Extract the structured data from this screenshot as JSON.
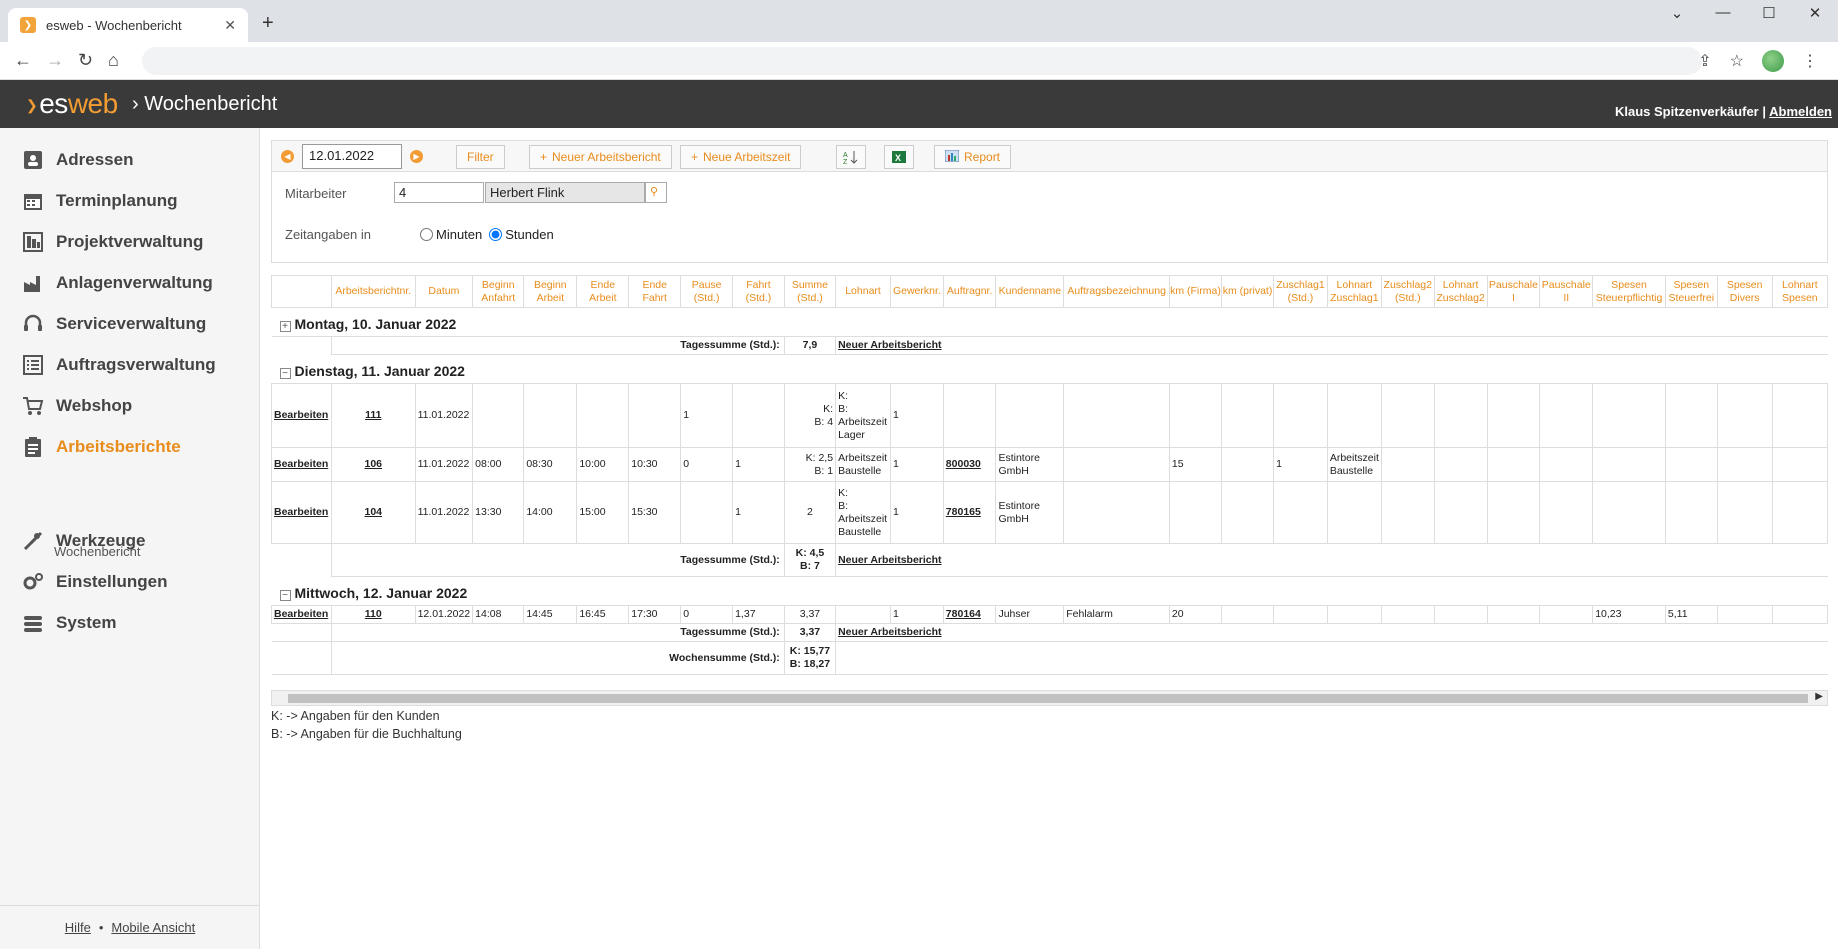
{
  "browser": {
    "tab_title": "esweb - Wochenbericht",
    "tab_close": "✕",
    "new_tab": "+",
    "win_min": "—",
    "win_max": "☐",
    "win_close": "✕",
    "chevron": "⌄"
  },
  "app": {
    "logo_es": "es",
    "logo_web": "web",
    "breadcrumb": "Wochenbericht",
    "user": "Klaus Spitzenverkäufer",
    "separator": "|",
    "logout": "Abmelden"
  },
  "sidebar": {
    "items": [
      {
        "label": "Adressen",
        "icon": "address-card-icon"
      },
      {
        "label": "Terminplanung",
        "icon": "calendar-icon"
      },
      {
        "label": "Projektverwaltung",
        "icon": "project-icon"
      },
      {
        "label": "Anlagenverwaltung",
        "icon": "factory-icon"
      },
      {
        "label": "Serviceverwaltung",
        "icon": "headset-icon"
      },
      {
        "label": "Auftragsverwaltung",
        "icon": "list-icon"
      },
      {
        "label": "Webshop",
        "icon": "cart-icon"
      },
      {
        "label": "Arbeitsberichte",
        "icon": "clipboard-icon"
      },
      {
        "label": "Werkzeuge",
        "icon": "tools-icon"
      },
      {
        "label": "Einstellungen",
        "icon": "gears-icon"
      },
      {
        "label": "System",
        "icon": "database-icon"
      }
    ],
    "sub_item": "Wochenbericht",
    "footer_help": "Hilfe",
    "footer_dot": "•",
    "footer_mobile": "Mobile Ansicht"
  },
  "toolbar": {
    "date": "12.01.2022",
    "filter": "Filter",
    "new_report": "Neuer Arbeitsbericht",
    "new_time": "Neue Arbeitszeit",
    "report": "Report"
  },
  "filter": {
    "employee_label": "Mitarbeiter",
    "employee_id": "4",
    "employee_name": "Herbert Flink",
    "time_label": "Zeitangaben in",
    "minutes": "Minuten",
    "hours": "Stunden"
  },
  "table": {
    "headers": [
      "",
      "Arbeitsberichtnr.",
      "Datum",
      "Beginn Anfahrt",
      "Beginn Arbeit",
      "Ende Arbeit",
      "Ende Fahrt",
      "Pause (Std.)",
      "Fahrt (Std.)",
      "Summe (Std.)",
      "Lohnart",
      "Gewerknr.",
      "Auftragnr.",
      "Kundenname",
      "Auftragsbezeichnung",
      "km (Firma)",
      "km (privat)",
      "Zuschlag1 (Std.)",
      "Lohnart Zuschlag1",
      "Zuschlag2 (Std.)",
      "Lohnart Zuschlag2",
      "Pauschale I",
      "Pauschale II",
      "Spesen Steuerpflichtig",
      "Spesen Steuerfrei",
      "Spesen Divers",
      "Lohnart Spesen"
    ],
    "edit_label": "Bearbeiten",
    "new_report_link": "Neuer Arbeitsbericht",
    "day_sum_label": "Tagessumme (Std.):",
    "week_sum_label": "Wochensumme (Std.):",
    "week_sum_k": "K: 15,77",
    "week_sum_b": "B: 18,27",
    "days": [
      {
        "title": "Montag, 10. Januar 2022",
        "toggle": "+",
        "sum": "7,9",
        "rows": []
      },
      {
        "title": "Dienstag, 11. Januar 2022",
        "toggle": "−",
        "sum_k": "K: 4,5",
        "sum_b": "B: 7",
        "rows": [
          {
            "nr": "111",
            "date": "11.01.2022",
            "ba": "",
            "barb": "",
            "earb": "",
            "ef": "",
            "pause": "1",
            "fahrt": "",
            "sum_k": "K:",
            "sum_b": "B: 4",
            "lohnart": "K:\nB:\nArbeitszeit\nLager",
            "gewerk": "1",
            "auftrag": "",
            "kunde": "",
            "bez": "",
            "kmf": "",
            "z1": "",
            "lz1": "",
            "sst": ""
          },
          {
            "nr": "106",
            "date": "11.01.2022",
            "ba": "08:00",
            "barb": "08:30",
            "earb": "10:00",
            "ef": "10:30",
            "pause": "0",
            "fahrt": "1",
            "sum_k": "K: 2,5",
            "sum_b": "B: 1",
            "lohnart": "Arbeitszeit\nBaustelle",
            "gewerk": "1",
            "auftrag": "800030",
            "kunde": "Estintore\nGmbH",
            "bez": "",
            "kmf": "15",
            "z1": "1",
            "lz1": "Arbeitszeit\nBaustelle",
            "sst": ""
          },
          {
            "nr": "104",
            "date": "11.01.2022",
            "ba": "13:30",
            "barb": "14:00",
            "earb": "15:00",
            "ef": "15:30",
            "pause": "",
            "fahrt": "1",
            "sum_k": "2",
            "sum_b": "",
            "lohnart": "K:\nB:\nArbeitszeit\nBaustelle",
            "gewerk": "1",
            "auftrag": "780165",
            "kunde": "Estintore\nGmbH",
            "bez": "",
            "kmf": "",
            "z1": "",
            "lz1": "",
            "sst": ""
          }
        ]
      },
      {
        "title": "Mittwoch, 12. Januar 2022",
        "toggle": "−",
        "sum": "3,37",
        "rows": [
          {
            "nr": "110",
            "date": "12.01.2022",
            "ba": "14:08",
            "barb": "14:45",
            "earb": "16:45",
            "ef": "17:30",
            "pause": "0",
            "fahrt": "1,37",
            "sum_k": "3,37",
            "sum_b": "",
            "lohnart": "",
            "gewerk": "1",
            "auftrag": "780164",
            "kunde": "Juhser",
            "bez": "Fehlalarm",
            "kmf": "20",
            "z1": "",
            "lz1": "",
            "sst": "10,23",
            "sfrei": "5,11"
          }
        ]
      }
    ]
  },
  "legend": {
    "k": "K: -> Angaben für den Kunden",
    "b": "B: -> Angaben für die Buchhaltung"
  }
}
